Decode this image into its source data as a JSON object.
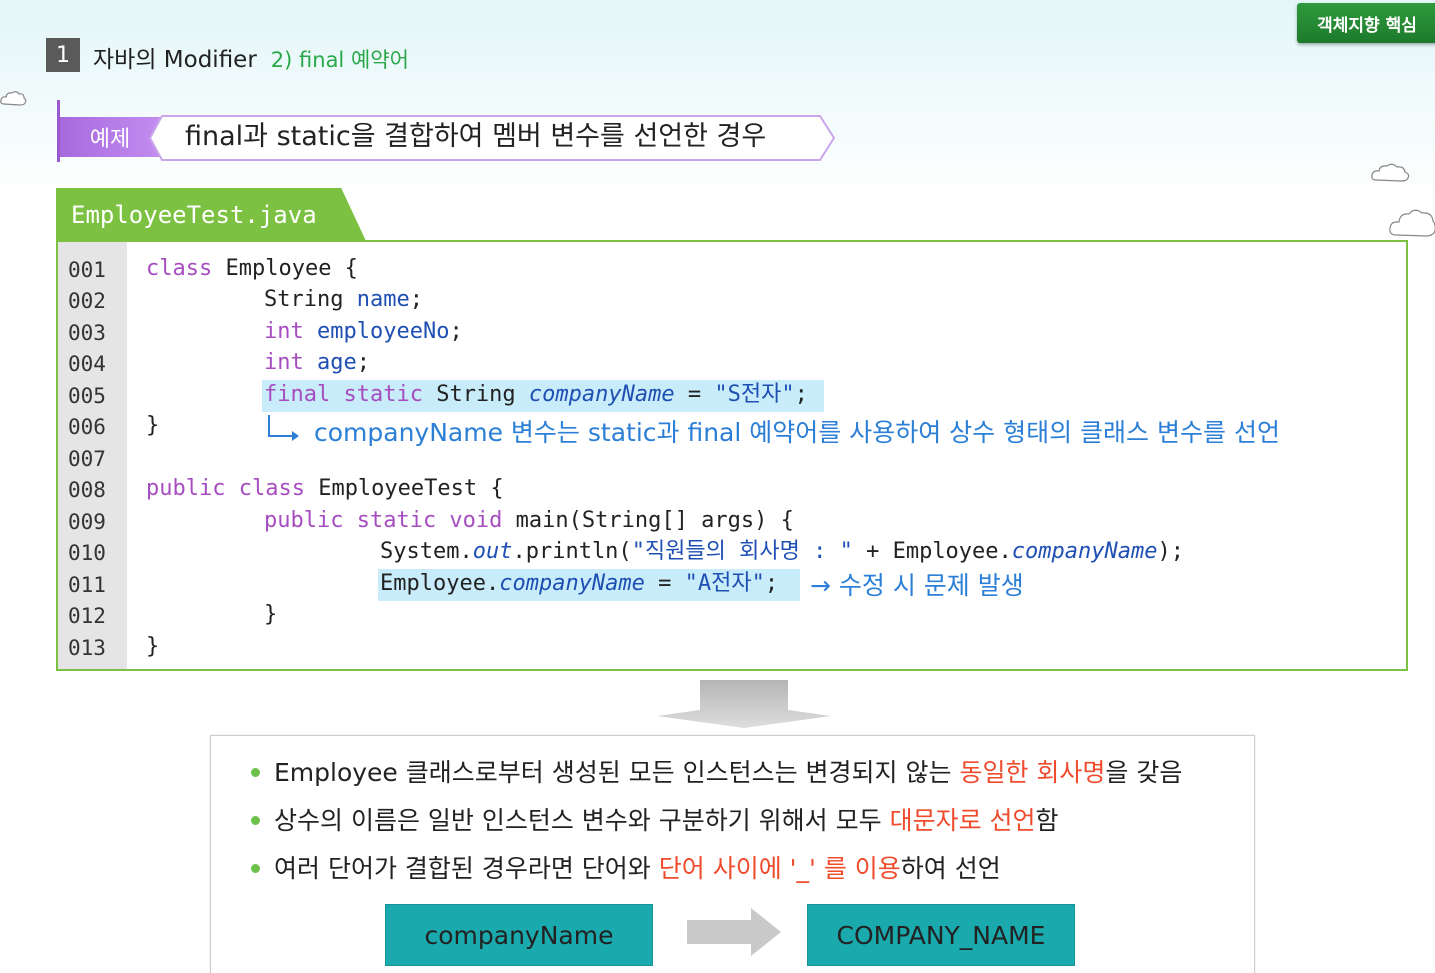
{
  "header": {
    "badge": "객체지향 핵심",
    "section_number": "1",
    "section_title": "자바의 Modifier",
    "section_subtitle": "2) final 예약어"
  },
  "example": {
    "label": "예제",
    "title": "final과 static을 결합하여 멤버 변수를 선언한 경우"
  },
  "code": {
    "filename": "EmployeeTest.java",
    "line_numbers": [
      "001",
      "002",
      "003",
      "004",
      "005",
      "006",
      "007",
      "008",
      "009",
      "010",
      "011",
      "012",
      "013"
    ],
    "tokens": {
      "l1_kw": "class",
      "l1_rest": " Employee {",
      "l2_type": "String ",
      "l2_fld": "name",
      "l2_end": ";",
      "l3_kw": "int ",
      "l3_fld": "employeeNo",
      "l3_end": ";",
      "l4_kw": "int ",
      "l4_fld": "age",
      "l4_end": ";",
      "l5_kw": "final static",
      "l5_type": " String ",
      "l5_ital": "companyName",
      "l5_eq": " = ",
      "l5_str": "\"S전자\"",
      "l5_end": ";",
      "l6": "}",
      "l8_kw": "public class",
      "l8_rest": " EmployeeTest {",
      "l9_kw": "public static void",
      "l9_rest": " main(String[] args) {",
      "l10_a": "System.",
      "l10_out": "out",
      "l10_b": ".println(",
      "l10_str": "\"직원들의 회사명 : \"",
      "l10_c": " + Employee.",
      "l10_ital": "companyName",
      "l10_d": ");",
      "l11_a": "Employee.",
      "l11_ital": "companyName",
      "l11_eq": " = ",
      "l11_str": "\"A전자\"",
      "l11_end": ";",
      "l12": "}",
      "l13": "}"
    },
    "note_line6": "companyName 변수는 static과 final 예약어를 사용하여 상수 형태의 클래스 변수를 선언",
    "note_line11": "→ 수정 시 문제 발생"
  },
  "summary": {
    "b1_pre": "Employee 클래스로부터 생성된 모든 인스턴스는 변경되지 않는 ",
    "b1_red": "동일한 회사명",
    "b1_post": "을 갖음",
    "b2_pre": "상수의 이름은 일반 인스턴스 변수와 구분하기 위해서 모두 ",
    "b2_red": "대문자로 선언",
    "b2_post": "함",
    "b3_pre": "여러 단어가 결합된 경우라면 단어와 ",
    "b3_red1": "단어 사이에 '_' 를 이용",
    "b3_post": "하여 선언",
    "from_name": "companyName",
    "to_name": "COMPANY_NAME"
  },
  "colors": {
    "accent_green": "#7cc142",
    "example_purple": "#a86add",
    "keyword_purple": "#a64dbf",
    "field_blue": "#1f4fb3",
    "highlight": "#c8ecfa",
    "note_blue": "#2b7fd6",
    "emphasis_red": "#ef4b2d",
    "teal": "#1aa9ac"
  }
}
